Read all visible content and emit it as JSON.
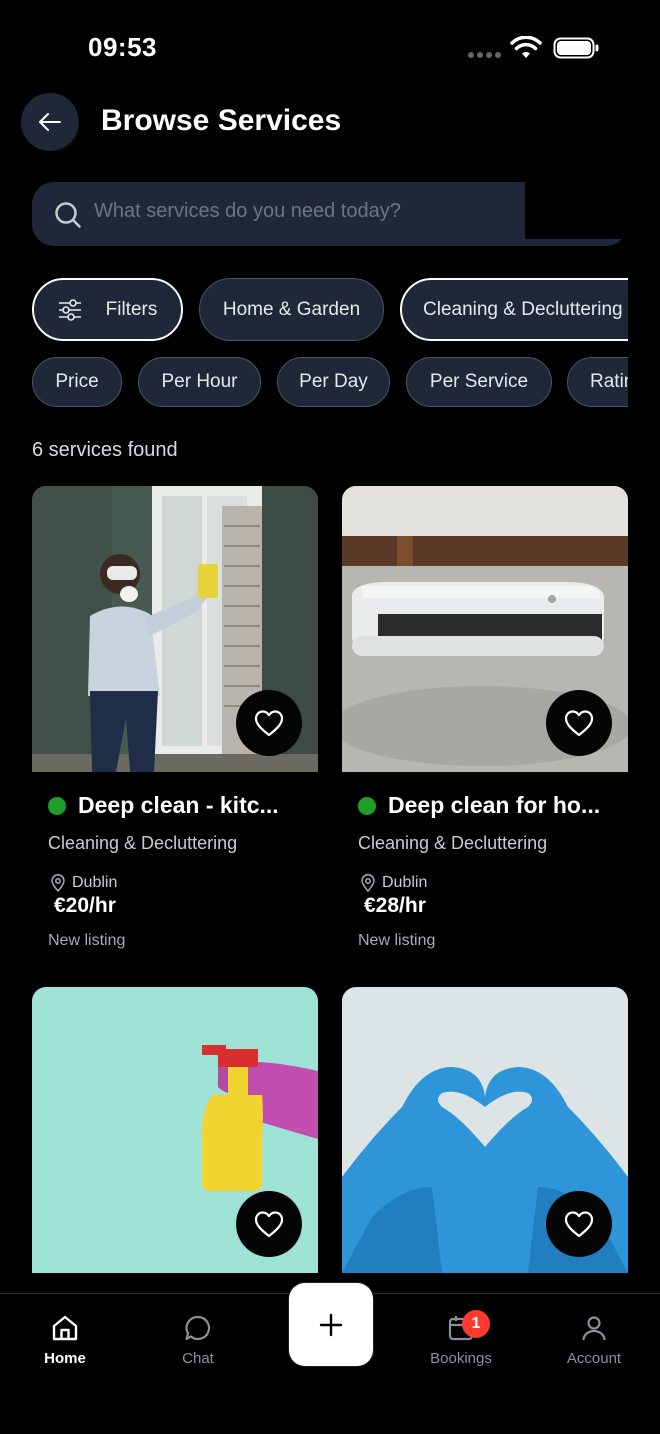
{
  "status_bar": {
    "time": "09:53"
  },
  "header": {
    "title": "Browse Services"
  },
  "search": {
    "placeholder": "What services do you need today?"
  },
  "filter_chips": [
    {
      "label": "Filters",
      "icon": "sliders-icon"
    },
    {
      "label": "Home & Garden"
    },
    {
      "label": "Cleaning & Decluttering",
      "selected": true
    }
  ],
  "sort_chips": [
    {
      "label": "Price"
    },
    {
      "label": "Per Hour"
    },
    {
      "label": "Per Day"
    },
    {
      "label": "Per Service"
    },
    {
      "label": "Rating"
    }
  ],
  "results": {
    "count_text": "6 services found"
  },
  "cards": [
    {
      "title": "Deep clean - kitc...",
      "category": "Cleaning & Decluttering",
      "location": "Dublin",
      "price": "€20/hr",
      "badge": "New listing",
      "status_color": "#1f9e2a"
    },
    {
      "title": "Deep clean for ho...",
      "category": "Cleaning & Decluttering",
      "location": "Dublin",
      "price": "€28/hr",
      "badge": "New listing",
      "status_color": "#1f9e2a"
    },
    {
      "title": "",
      "category": "",
      "location": "",
      "price": "",
      "badge": ""
    },
    {
      "title": "",
      "category": "",
      "location": "",
      "price": "",
      "badge": ""
    }
  ],
  "bottom_nav": {
    "items": [
      {
        "label": "Home",
        "icon": "home-icon",
        "active": true
      },
      {
        "label": "Chat",
        "icon": "chat-bubble-icon"
      },
      {
        "label": "Bookings",
        "icon": "calendar-icon",
        "badge": "1"
      },
      {
        "label": "Account",
        "icon": "person-icon"
      }
    ],
    "fab_icon": "plus-icon"
  },
  "colors": {
    "background": "#000000",
    "surface": "#1e2838",
    "accent_green": "#1f9e2a",
    "badge_red": "#ff3b30"
  }
}
